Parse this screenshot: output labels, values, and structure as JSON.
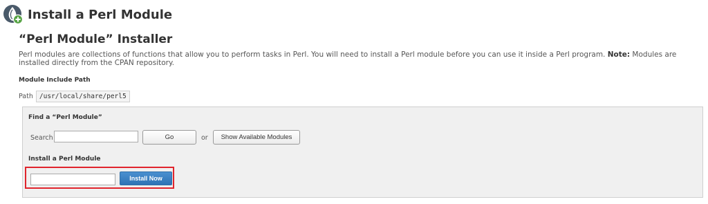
{
  "header": {
    "title": "Install a Perl Module",
    "logo_icon": "perl-onion-add-icon"
  },
  "installer": {
    "title": "“Perl Module” Installer",
    "description": "Perl modules are collections of functions that allow you to perform tasks in Perl. You will need to install a Perl module before you can use it inside a Perl program.",
    "note_label": "Note:",
    "note_text": "Modules are installed directly from the CPAN repository."
  },
  "include_path": {
    "heading": "Module Include Path",
    "label": "Path",
    "value": "/usr/local/share/perl5"
  },
  "find": {
    "heading": "Find a “Perl Module”",
    "search_label": "Search",
    "search_value": "",
    "go_label": "Go",
    "or_text": "or",
    "show_modules_label": "Show Available Modules"
  },
  "install": {
    "heading": "Install a Perl Module",
    "input_value": "",
    "button_label": "Install Now",
    "highlight_color": "#e0242c",
    "button_color": "#3a80c3"
  }
}
